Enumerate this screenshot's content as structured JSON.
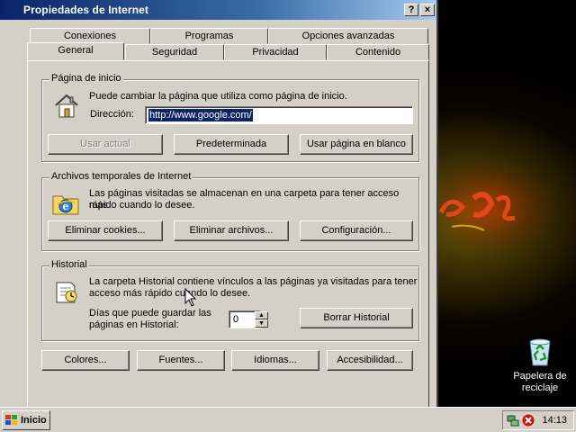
{
  "window": {
    "title": "Propiedades de Internet",
    "help_glyph": "?",
    "close_glyph": "×"
  },
  "tabs_back": [
    "Conexiones",
    "Programas",
    "Opciones avanzadas"
  ],
  "tabs_front": [
    "General",
    "Seguridad",
    "Privacidad",
    "Contenido"
  ],
  "active_tab": "General",
  "home": {
    "legend": "Página de inicio",
    "description": "Puede cambiar la página que utiliza como página de inicio.",
    "address_label": "Dirección:",
    "address_value": "http://www.google.com/",
    "btn_current": "Usar actual",
    "btn_default": "Predeterminada",
    "btn_blank": "Usar página en blanco"
  },
  "temp": {
    "legend": "Archivos temporales de Internet",
    "description_1": "Las páginas visitadas se almacenan en una carpeta para tener acceso más",
    "description_2": "rápido cuando lo desee.",
    "btn_cookies": "Eliminar cookies...",
    "btn_files": "Eliminar archivos...",
    "btn_config": "Configuración..."
  },
  "history": {
    "legend": "Historial",
    "description_1": "La carpeta Historial contiene vínculos a las páginas ya visitadas para tener",
    "description_2": "acceso más rápido cuando lo desee.",
    "days_label_1": "Días que puede guardar las",
    "days_label_2": "páginas en Historial:",
    "days_value": "0",
    "btn_clear": "Borrar Historial"
  },
  "bottom_buttons": {
    "colors": "Colores...",
    "fonts": "Fuentes...",
    "languages": "Idiomas...",
    "accessibility": "Accesibilidad..."
  },
  "desktop": {
    "recycle_label_1": "Papelera de",
    "recycle_label_2": "reciclaje"
  },
  "taskbar": {
    "start_label": "Inicio",
    "clock": "14:13"
  },
  "colors": {
    "title_active": "#0a246a",
    "selection": "#0a246a",
    "face": "#d4d0c8"
  }
}
